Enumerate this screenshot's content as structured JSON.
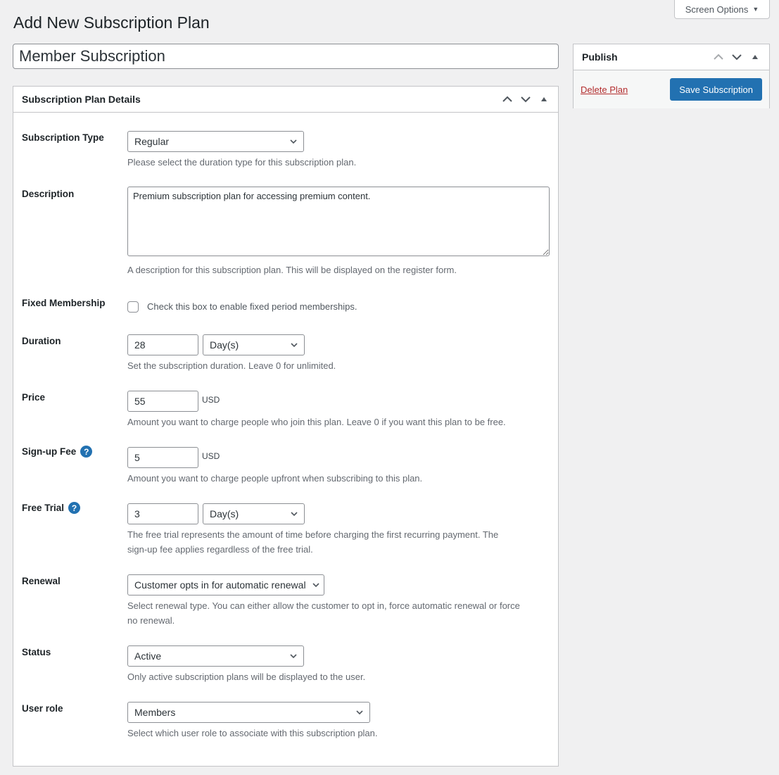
{
  "screen_options": {
    "label": "Screen Options"
  },
  "page": {
    "title": "Add New Subscription Plan",
    "plan_name": "Member Subscription"
  },
  "publish": {
    "title": "Publish",
    "delete_label": "Delete Plan",
    "save_label": "Save Subscription"
  },
  "details": {
    "title": "Subscription Plan Details",
    "subscription_type": {
      "label": "Subscription Type",
      "value": "Regular",
      "hint": "Please select the duration type for this subscription plan."
    },
    "description": {
      "label": "Description",
      "value": "Premium subscription plan for accessing premium content.",
      "hint": "A description for this subscription plan. This will be displayed on the register form."
    },
    "fixed_membership": {
      "label": "Fixed Membership",
      "checked": false,
      "checkbox_label": "Check this box to enable fixed period memberships."
    },
    "duration": {
      "label": "Duration",
      "value": "28",
      "unit": "Day(s)",
      "hint": "Set the subscription duration. Leave 0 for unlimited."
    },
    "price": {
      "label": "Price",
      "value": "55",
      "currency": "USD",
      "hint": "Amount you want to charge people who join this plan. Leave 0 if you want this plan to be free."
    },
    "signup_fee": {
      "label": "Sign-up Fee",
      "value": "5",
      "currency": "USD",
      "hint": "Amount you want to charge people upfront when subscribing to this plan."
    },
    "free_trial": {
      "label": "Free Trial",
      "value": "3",
      "unit": "Day(s)",
      "hint_line1": "The free trial represents the amount of time before charging the first recurring payment. The",
      "hint_line2": "sign-up fee applies regardless of the free trial."
    },
    "renewal": {
      "label": "Renewal",
      "value": "Customer opts in for automatic renewal",
      "hint_line1": "Select renewal type. You can either allow the customer to opt in, force automatic renewal or force",
      "hint_line2": "no renewal."
    },
    "status": {
      "label": "Status",
      "value": "Active",
      "hint": "Only active subscription plans will be displayed to the user."
    },
    "user_role": {
      "label": "User role",
      "value": "Members",
      "hint": "Select which user role to associate with this subscription plan."
    }
  },
  "icons": {
    "help": "?"
  }
}
